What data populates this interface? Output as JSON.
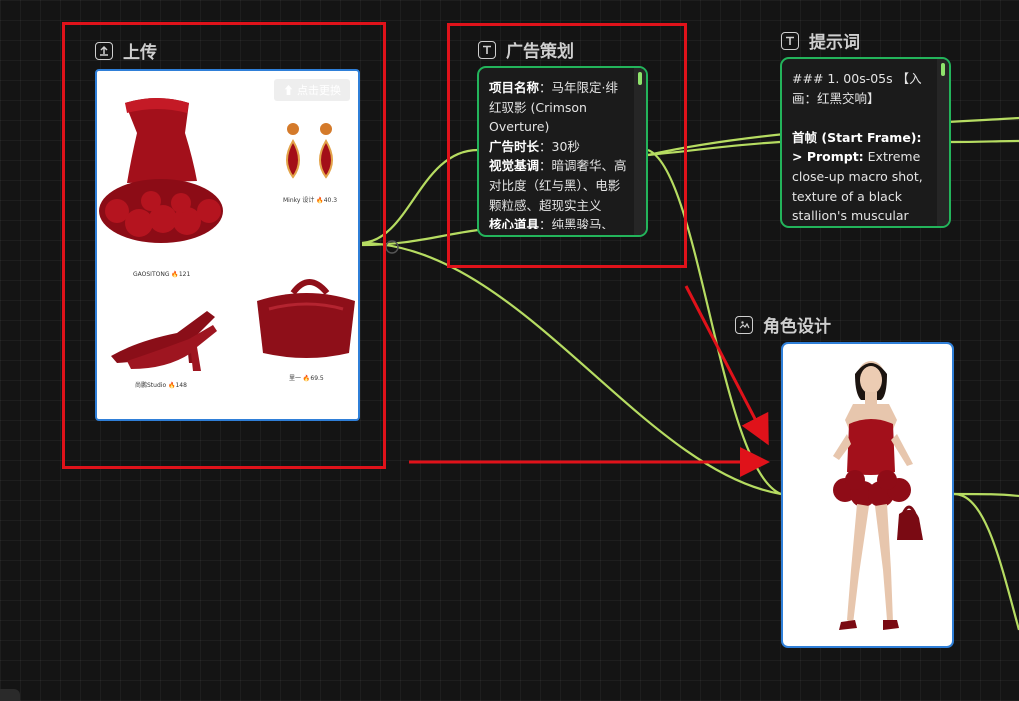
{
  "nodes": {
    "upload": {
      "title": "上传",
      "icon": "upload-icon",
      "replace_button": "⬆ 点击更换",
      "products": [
        {
          "caption": "GAOSITONG 🔥121",
          "item": "red-strapless-dress"
        },
        {
          "caption": "Minky 设计 🔥40.3",
          "item": "ruby-earrings"
        },
        {
          "caption": "尚鹏Studio 🔥148",
          "item": "red-slingback-heels"
        },
        {
          "caption": "里一 🔥69.5",
          "item": "red-handbag"
        }
      ]
    },
    "ad_plan": {
      "title": "广告策划",
      "icon": "text-icon",
      "lines": [
        {
          "label": "项目名称",
          "value": "：马年限定·绯红驭影 (Crimson Overture)"
        },
        {
          "label": "广告时长",
          "value": "：30秒"
        },
        {
          "label": "视觉基调",
          "value": "：暗调奢华、高对比度（红与黑）、电影颗粒感、超现实主义"
        },
        {
          "label": "核心道具",
          "value": "：纯黑骏马、"
        }
      ]
    },
    "prompt": {
      "title": "提示词",
      "icon": "text-icon",
      "line1": "### 1. 00s-05s 【入画：红黑交响】",
      "first_frame_label": "首帧 (Start Frame):",
      "prompt_label": "> Prompt:",
      "prompt_text": " Extreme close-up macro shot, texture of a black stallion's muscular"
    },
    "role": {
      "title": "角色设计",
      "icon": "image-icon"
    }
  },
  "colors": {
    "background": "#141414",
    "connector": "#c8f26a",
    "annotation_red": "#e0121a",
    "selected_blue": "#2f7fd8",
    "text_node_green": "#23b45b"
  }
}
